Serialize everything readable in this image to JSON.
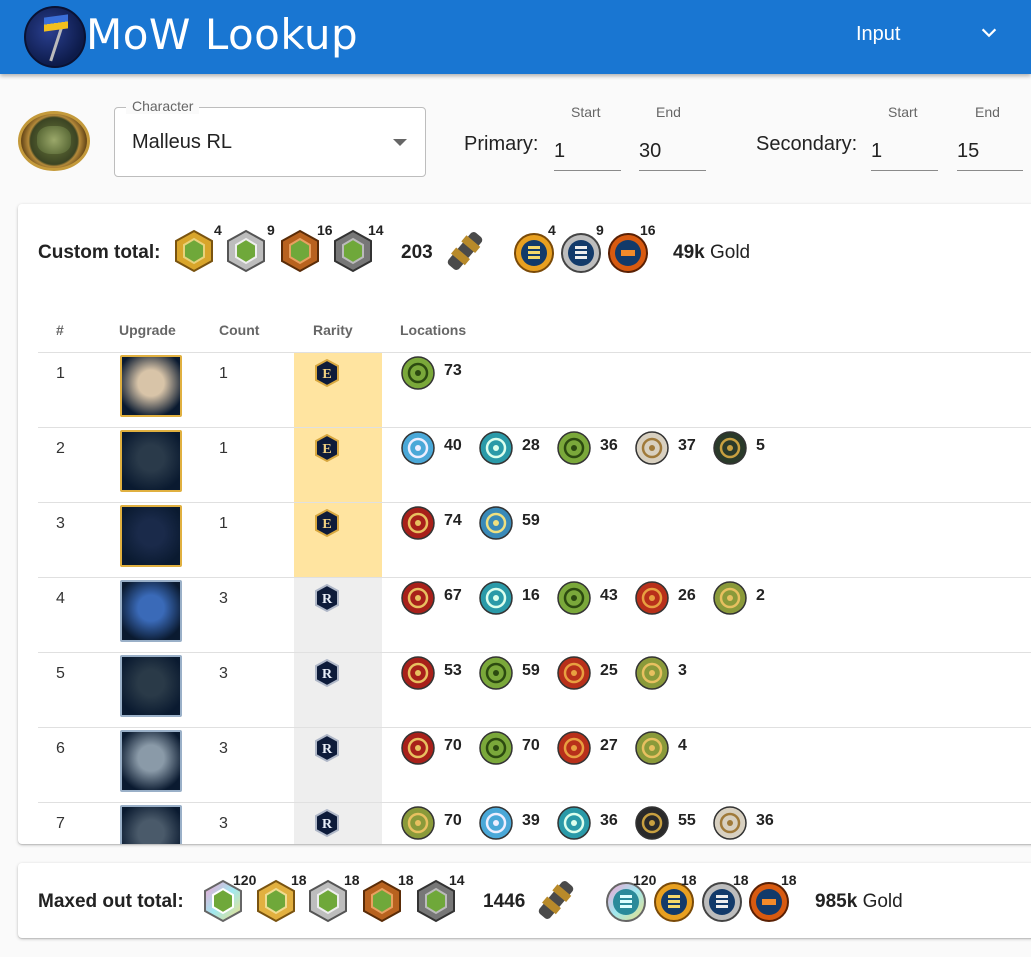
{
  "app": {
    "title": "MoW Lookup",
    "input_menu_label": "Input",
    "colors": {
      "appbar": "#1976d2",
      "epic_bg": "#ffe4a0",
      "rare_bg": "#eeeeee"
    }
  },
  "character": {
    "legend": "Character",
    "selected": "Malleus RL",
    "avatar_icon": "malleus-rocket-launcher-portrait"
  },
  "ranges": {
    "primary": {
      "label": "Primary:",
      "start_caption": "Start",
      "end_caption": "End",
      "start": "1",
      "end": "30"
    },
    "secondary": {
      "label": "Secondary:",
      "start_caption": "Start",
      "end_caption": "End",
      "start": "1",
      "end": "15"
    }
  },
  "custom_total": {
    "label": "Custom total:",
    "badges": [
      {
        "icon": "gold-badge-icon",
        "count": ""
      },
      {
        "icon": "silver-badge-icon",
        "count": "4"
      },
      {
        "icon": "bronze-badge-icon",
        "count": "9"
      },
      {
        "icon": "grey-badge-icon",
        "count": "16"
      },
      {
        "icon": "",
        "count": "14"
      }
    ],
    "components": "203",
    "forge": [
      {
        "icon": "blue-forge-badge-icon",
        "count": ""
      },
      {
        "icon": "silver-forge-badge-icon",
        "count": "4"
      },
      {
        "icon": "orange-forge-badge-icon",
        "count": "9"
      },
      {
        "icon": "",
        "count": "16"
      }
    ],
    "gold_value": "49k",
    "gold_label": "Gold"
  },
  "table": {
    "headers": {
      "num": "#",
      "upgrade": "Upgrade",
      "count": "Count",
      "rarity": "Rarity",
      "locations": "Locations"
    },
    "rows": [
      {
        "num": "1",
        "count": "1",
        "rarity": "E",
        "upgrade_icon": "cloth-scroll-icon",
        "locations": [
          {
            "icon": "green-node-icon",
            "value": "73"
          }
        ]
      },
      {
        "num": "2",
        "count": "1",
        "rarity": "E",
        "upgrade_icon": "skull-chest-icon",
        "locations": [
          {
            "icon": "blue-trident-icon",
            "value": "40"
          },
          {
            "icon": "teal-gear-icon",
            "value": "28"
          },
          {
            "icon": "green-node-icon",
            "value": "36"
          },
          {
            "icon": "silver-winged-icon",
            "value": "37"
          },
          {
            "icon": "dark-winged-icon",
            "value": "5"
          }
        ]
      },
      {
        "num": "3",
        "count": "1",
        "rarity": "E",
        "upgrade_icon": "mechanical-claw-icon",
        "locations": [
          {
            "icon": "red-gear-icon",
            "value": "74"
          },
          {
            "icon": "blue-triangle-icon",
            "value": "59"
          }
        ]
      },
      {
        "num": "4",
        "count": "3",
        "rarity": "R",
        "upgrade_icon": "medal-ribbon-icon",
        "locations": [
          {
            "icon": "red-gear-icon",
            "value": "67"
          },
          {
            "icon": "teal-gear-icon",
            "value": "16"
          },
          {
            "icon": "green-node-icon",
            "value": "43"
          },
          {
            "icon": "red-winged-icon",
            "value": "26"
          },
          {
            "icon": "gold-winged-icon",
            "value": "2"
          }
        ]
      },
      {
        "num": "5",
        "count": "3",
        "rarity": "R",
        "upgrade_icon": "shovel-icon",
        "locations": [
          {
            "icon": "red-gear-icon",
            "value": "53"
          },
          {
            "icon": "green-node-icon",
            "value": "59"
          },
          {
            "icon": "red-winged-icon",
            "value": "25"
          },
          {
            "icon": "gold-winged-icon",
            "value": "3"
          }
        ]
      },
      {
        "num": "6",
        "count": "3",
        "rarity": "R",
        "upgrade_icon": "bandage-wrap-icon",
        "locations": [
          {
            "icon": "red-gear-icon",
            "value": "70"
          },
          {
            "icon": "green-node-icon",
            "value": "70"
          },
          {
            "icon": "red-winged-icon",
            "value": "27"
          },
          {
            "icon": "gold-winged-icon",
            "value": "4"
          }
        ]
      },
      {
        "num": "7",
        "count": "3",
        "rarity": "R",
        "upgrade_icon": "bolt-icon",
        "locations": [
          {
            "icon": "gold-winged-icon",
            "value": "70"
          },
          {
            "icon": "blue-trident-icon",
            "value": "39"
          },
          {
            "icon": "teal-gear-icon",
            "value": "36"
          },
          {
            "icon": "dark-cross-icon",
            "value": "55"
          },
          {
            "icon": "silver-winged-icon",
            "value": "36"
          }
        ]
      }
    ]
  },
  "maxed_total": {
    "label": "Maxed out total:",
    "badges": [
      {
        "icon": "diamond-badge-icon",
        "count": ""
      },
      {
        "icon": "gold-badge-icon",
        "count": "120"
      },
      {
        "icon": "silver-badge-icon",
        "count": "18"
      },
      {
        "icon": "bronze-badge-icon",
        "count": "18"
      },
      {
        "icon": "grey-badge-icon",
        "count": "18"
      },
      {
        "icon": "",
        "count": "14"
      }
    ],
    "components": "1446",
    "forge": [
      {
        "icon": "diamond-forge-badge-icon",
        "count": ""
      },
      {
        "icon": "blue-forge-badge-icon",
        "count": "120"
      },
      {
        "icon": "silver-forge-badge-icon",
        "count": "18"
      },
      {
        "icon": "orange-forge-badge-icon",
        "count": "18"
      },
      {
        "icon": "",
        "count": "18"
      }
    ],
    "gold_value": "985k",
    "gold_label": "Gold"
  }
}
